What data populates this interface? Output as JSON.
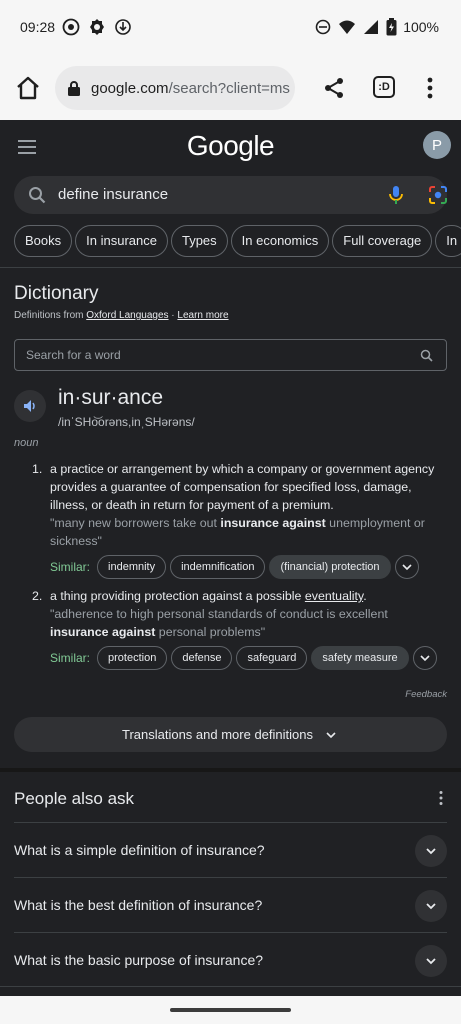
{
  "status_bar": {
    "time": "09:28",
    "battery": "100%",
    "left_icons": [
      "app-notification-icon",
      "gear-notification-icon",
      "download-notification-icon"
    ],
    "right_icons": [
      "dnd-icon",
      "wifi-icon",
      "signal-icon",
      "battery-icon"
    ]
  },
  "browser": {
    "url_domain": "google.com",
    "url_path": "/search?client=ms",
    "tab_switcher_label": ":D"
  },
  "google": {
    "logo": "Google",
    "avatar_letter": "P",
    "search_query": "define insurance",
    "chips": [
      "Books",
      "In insurance",
      "Types",
      "In economics",
      "Full coverage",
      "In"
    ]
  },
  "dictionary": {
    "title": "Dictionary",
    "source_prefix": "Definitions from ",
    "source_name": "Oxford Languages",
    "source_sep": " · ",
    "learn_more": "Learn more",
    "word_search_placeholder": "Search for a word",
    "headword": "in·sur·ance",
    "phonetic": "/inˈSHo͝orəns,inˌSHərəns/",
    "part_of_speech": "noun",
    "definitions": [
      {
        "number": "1.",
        "text": "a practice or arrangement by which a company or government agency provides a guarantee of compensation for specified loss, damage, illness, or death in return for payment of a premium.",
        "example_open": "\"many new borrowers take out ",
        "example_bold": "insurance against",
        "example_close": " unemployment or sickness\"",
        "similar_label": "Similar:",
        "similar": [
          "indemnity",
          "indemnification",
          "(financial) protection"
        ]
      },
      {
        "number": "2.",
        "text_before": "a thing providing protection against a possible ",
        "text_link": "eventuality",
        "text_after": ".",
        "example_open": "\"adherence to high personal standards of conduct is excellent ",
        "example_bold": "insurance against",
        "example_close": " personal problems\"",
        "similar_label": "Similar:",
        "similar": [
          "protection",
          "defense",
          "safeguard",
          "safety measure"
        ]
      }
    ],
    "feedback": "Feedback",
    "translations_button": "Translations and more definitions"
  },
  "people_also_ask": {
    "title": "People also ask",
    "questions": [
      "What is a simple definition of insurance?",
      "What is the best definition of insurance?",
      "What is the basic purpose of insurance?"
    ]
  },
  "colors": {
    "page_bg": "#202124",
    "surface": "#303134",
    "similar_label": "#81c995",
    "mic_blue": "#4285f4",
    "mic_yellow": "#fbbc04"
  }
}
